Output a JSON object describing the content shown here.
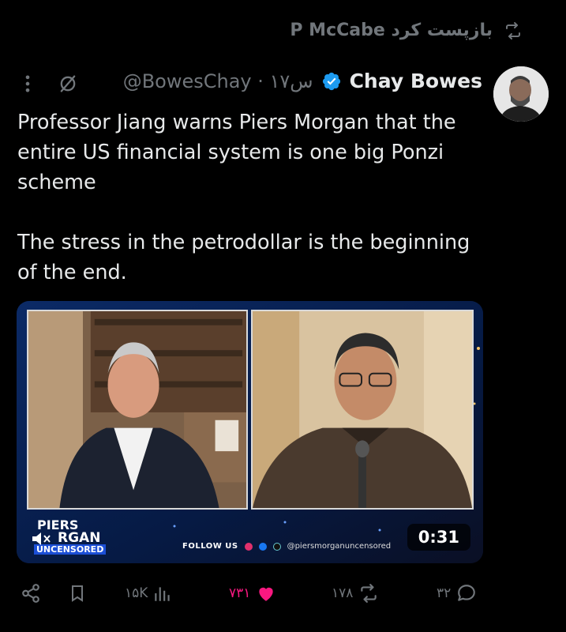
{
  "repost": {
    "text": "P McCabe بازپست کرد",
    "icon": "repost-icon"
  },
  "author": {
    "display_name": "Chay Bowes",
    "handle_time": "@BowesChay · ۱۷س",
    "verified": true,
    "verified_color": "#1d9bf0"
  },
  "tweet": {
    "text": "Professor Jiang warns Piers Morgan that the entire US financial system is one big Ponzi scheme\n\nThe stress in the petrodollar is the beginning of the end."
  },
  "video": {
    "logo_line1": "PIERS",
    "logo_line2": "RGAN",
    "logo_line3": "UNCENSORED",
    "follow_label": "FOLLOW US",
    "social_handle": "@piersmorganuncensored",
    "duration": "0:31"
  },
  "actions": {
    "views": "۱۵K",
    "likes": "۷۳۱",
    "reposts": "۱۷۸",
    "replies": "۳۲",
    "like_color": "#f91880"
  }
}
